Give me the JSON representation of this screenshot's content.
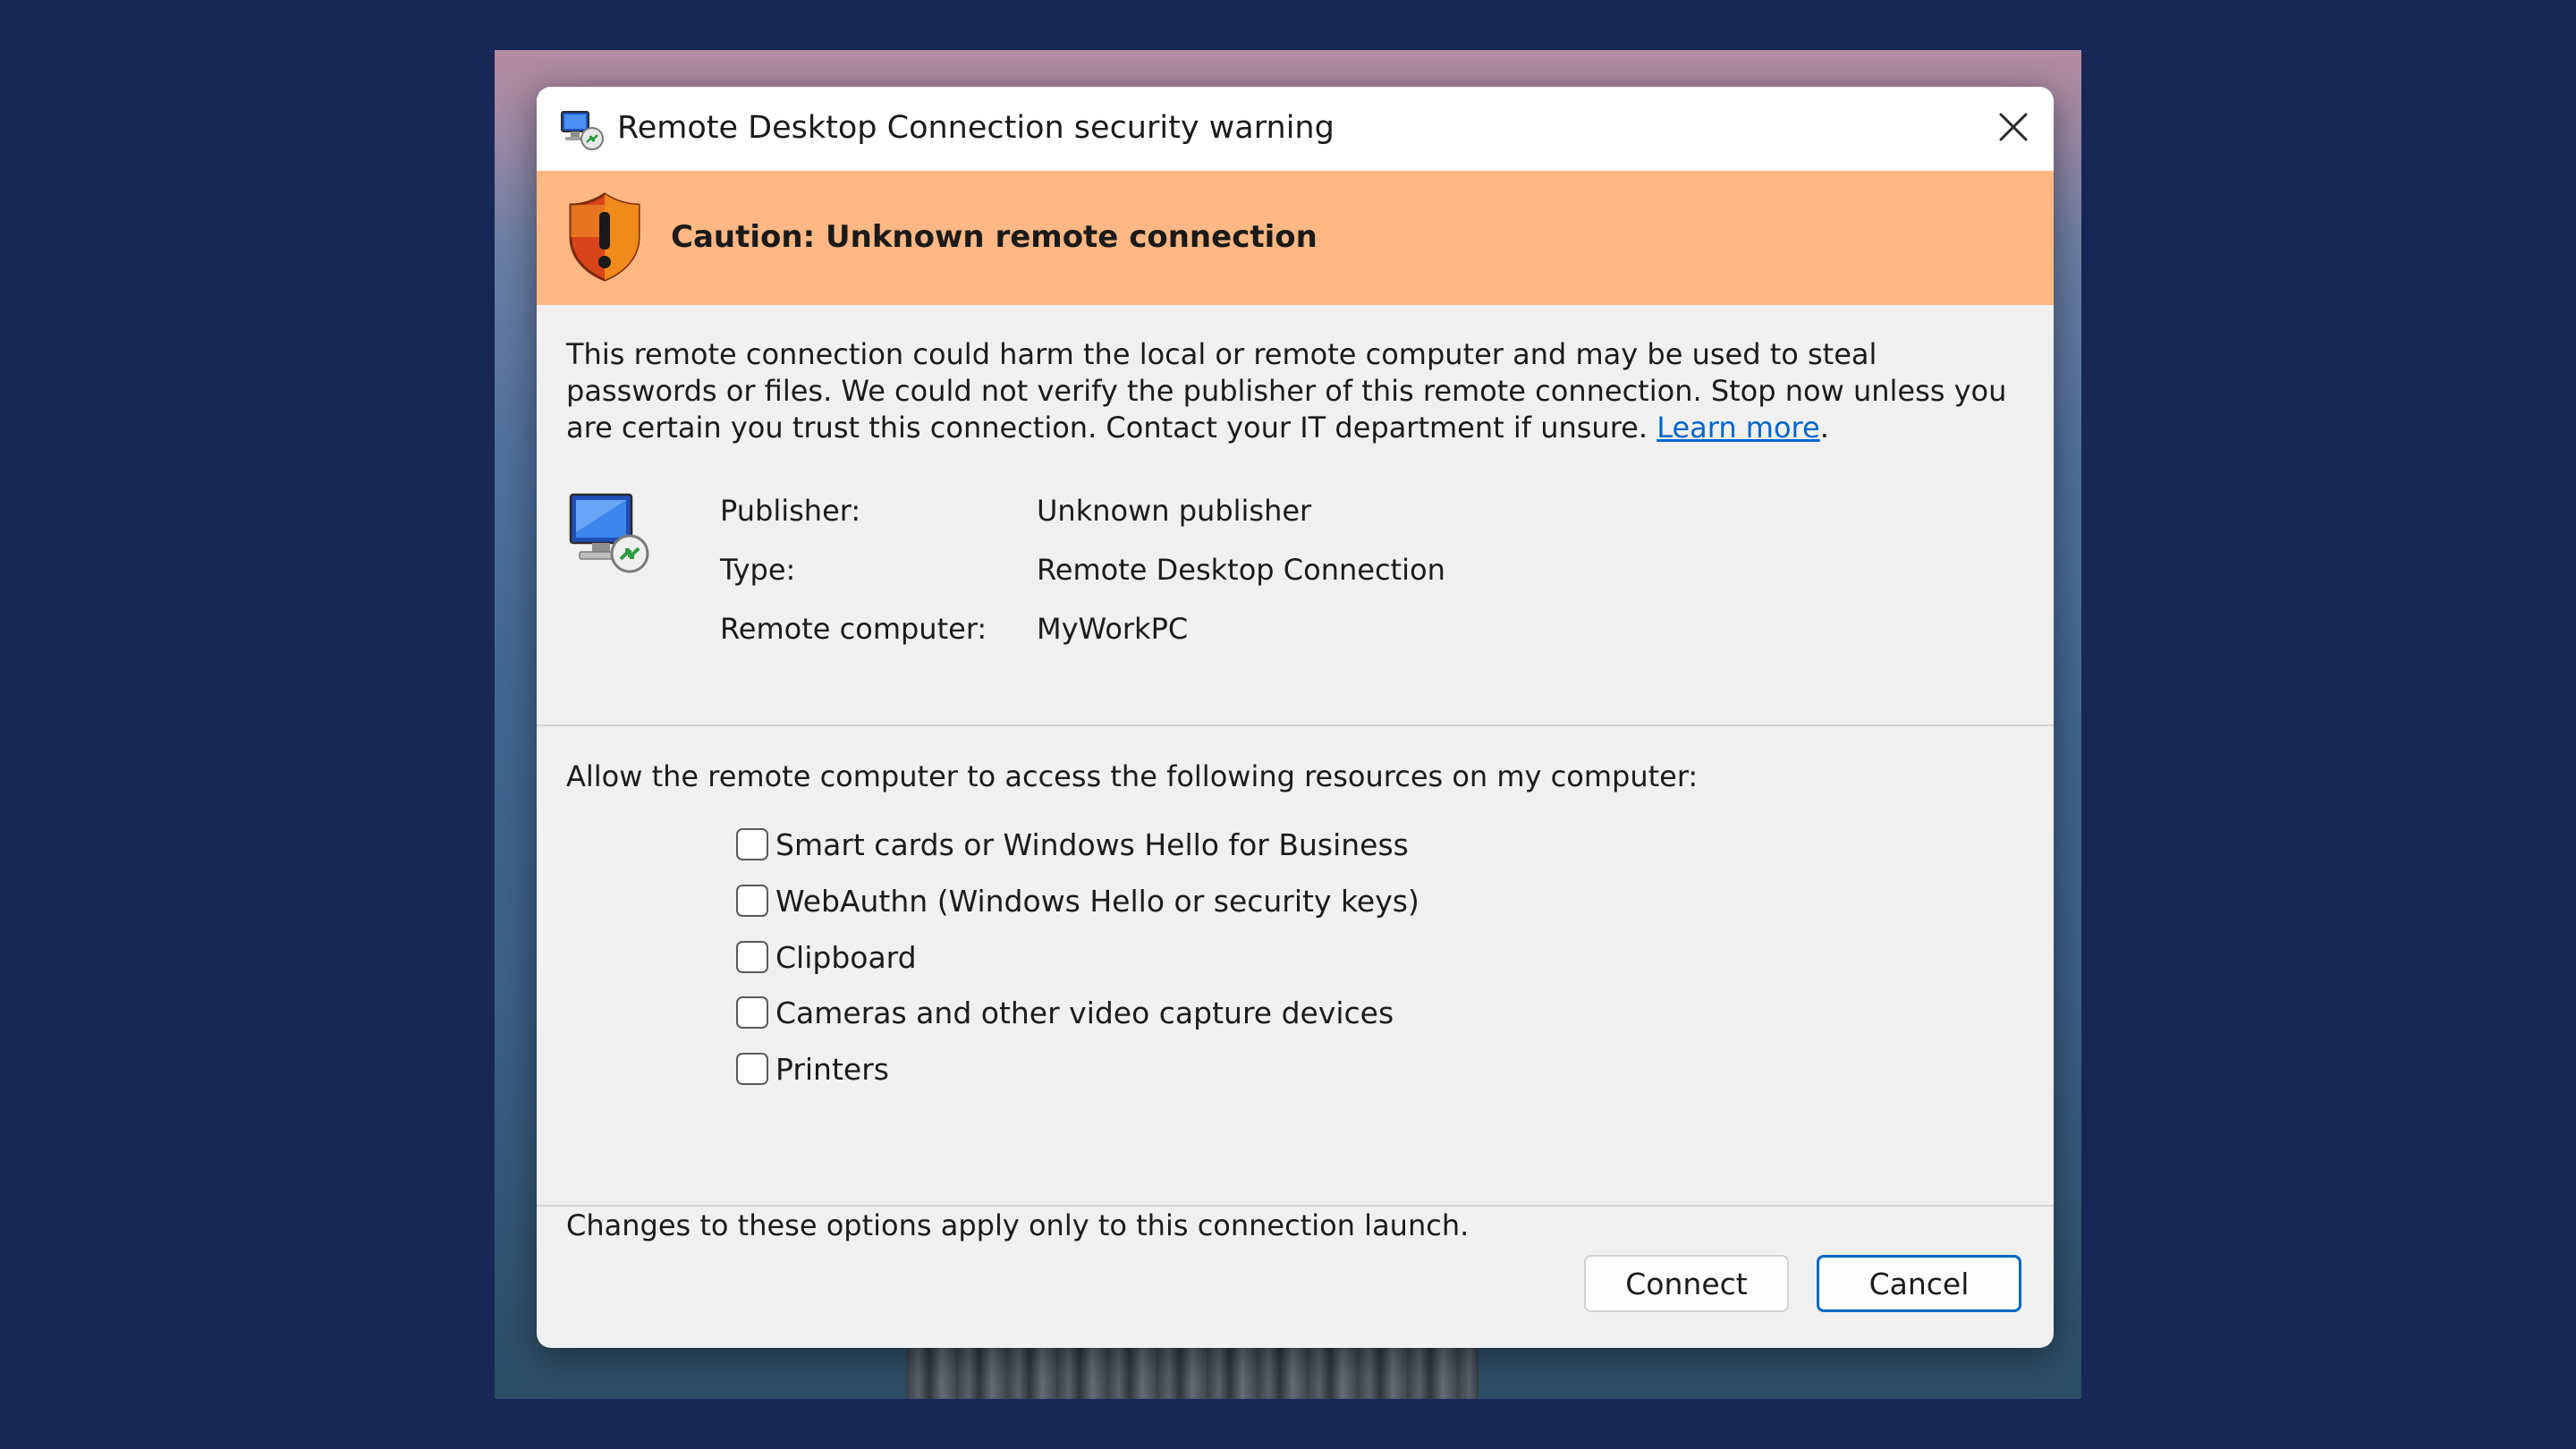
{
  "dialog": {
    "title": "Remote Desktop Connection security warning",
    "title_icon": "remote-desktop-icon",
    "close_icon": "close-icon"
  },
  "banner": {
    "icon": "shield-warning-icon",
    "text": "Caution: Unknown remote connection",
    "color": "#ffb784"
  },
  "warning": {
    "text": "This remote connection could harm the local or remote computer and may be used to steal passwords or files. We could not verify the publisher of this remote connection. Stop now unless you are certain you trust this connection. Contact your IT department if unsure. ",
    "link_text": "Learn more",
    "trailing": "."
  },
  "info": {
    "icon": "remote-computer-icon",
    "rows": [
      {
        "label": "Publisher:",
        "value": "Unknown publisher"
      },
      {
        "label": "Type:",
        "value": "Remote Desktop Connection"
      },
      {
        "label": "Remote computer:",
        "value": "MyWorkPC"
      }
    ]
  },
  "resources": {
    "heading": "Allow the remote computer to access the following resources on my computer:",
    "options": [
      {
        "label": "Smart cards or Windows Hello for Business",
        "checked": false
      },
      {
        "label": "WebAuthn (Windows Hello or security keys)",
        "checked": false
      },
      {
        "label": "Clipboard",
        "checked": false
      },
      {
        "label": "Cameras and other video capture devices",
        "checked": false
      },
      {
        "label": "Printers",
        "checked": false
      }
    ],
    "footnote": "Changes to these options apply only to this connection launch."
  },
  "buttons": {
    "connect": "Connect",
    "cancel": "Cancel"
  },
  "colors": {
    "background": "#172857",
    "accent": "#0067c0",
    "link": "#0066cc"
  }
}
